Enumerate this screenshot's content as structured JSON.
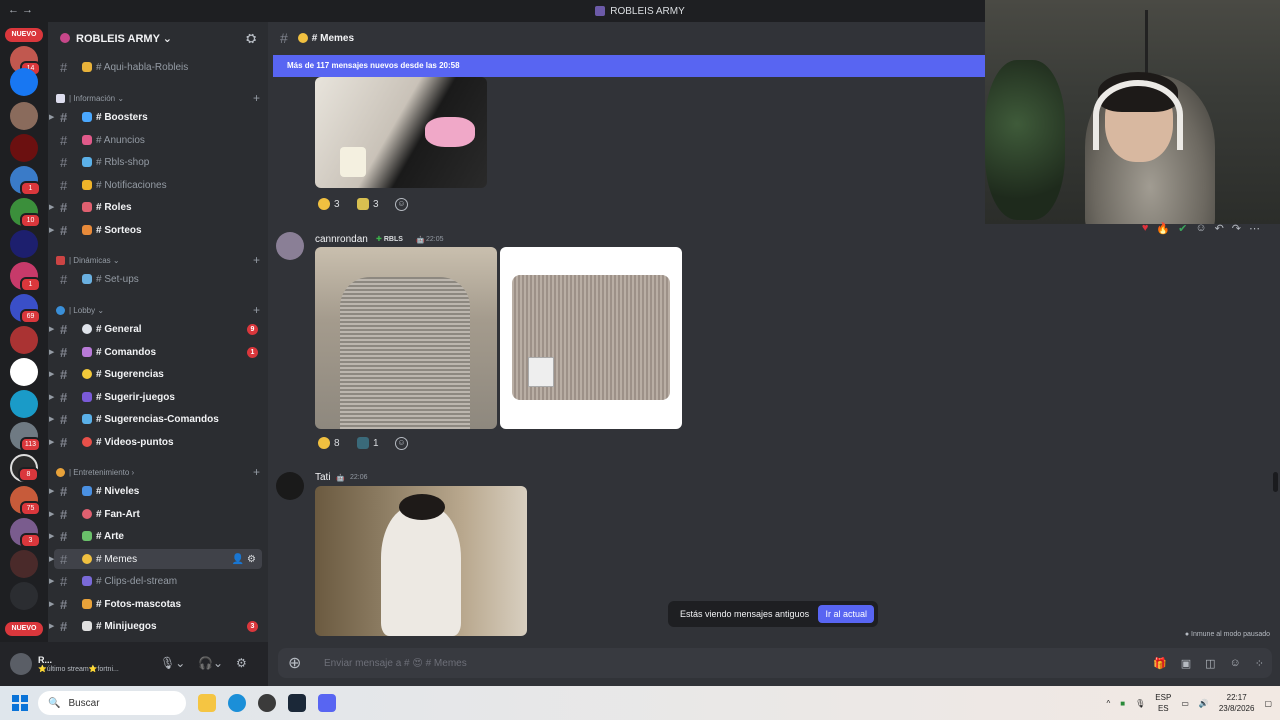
{
  "window": {
    "title": "ROBLEIS ARMY",
    "nav": "←  →"
  },
  "guild_badges": {
    "nuevo_top": "NUEVO",
    "nuevo_bottom": "NUEVO",
    "g1": "14",
    "g2": "1",
    "g3": "10",
    "g4": "1",
    "g5": "1",
    "g6": "69",
    "g7": "113",
    "g8": "8",
    "g9": "75",
    "g10": "3"
  },
  "server": {
    "name": "ROBLEIS ARMY ⌄"
  },
  "channels": {
    "aqui": "# Aqui-habla-Robleis",
    "cat_info": "| Información ⌄",
    "boosters": "# Boosters",
    "anuncios": "# Anuncios",
    "shop": "# Rbls-shop",
    "notif": "# Notificaciones",
    "roles": "# Roles",
    "sorteos": "# Sorteos",
    "cat_din": "| Dinámicas ⌄",
    "setups": "# Set-ups",
    "cat_lobby": "| Lobby ⌄",
    "general": "# General",
    "general_badge": "9",
    "comandos": "# Comandos",
    "comandos_badge": "1",
    "sugerencias": "# Sugerencias",
    "sugerir": "# Sugerir-juegos",
    "sugcom": "# Sugerencias-Comandos",
    "videos": "# Videos-puntos",
    "cat_ent": "| Entretenimiento ›",
    "niveles": "# Niveles",
    "fanart": "# Fan-Art",
    "arte": "# Arte",
    "memes": "# Memes",
    "clips": "# Clips-del-stream",
    "fotos": "# Fotos-mascotas",
    "minijuegos": "# Minijuegos",
    "minijuegos_badge": "3"
  },
  "user": {
    "name": "R...",
    "status": "⭐último stream⭐fortni..."
  },
  "chat": {
    "channel": "# Memes",
    "new_banner": "Más de 117 mensajes nuevos desde las 20:58",
    "msg1_reactions": {
      "a": "3",
      "b": "3"
    },
    "msg2": {
      "author": "cannrondan",
      "tag": "RBLS",
      "time": "22:05",
      "react_a": "8",
      "react_b": "1"
    },
    "msg3": {
      "author": "Tati",
      "time": "22:06"
    },
    "old_notice": "Estás viendo mensajes antiguos",
    "jump_button": "Ir al actual",
    "paused": "Inmune al modo pausado",
    "composer_placeholder": "Enviar mensaje a # 😍 # Memes"
  },
  "taskbar": {
    "search": "Buscar",
    "lang1": "ESP",
    "lang2": "ES",
    "time": "22:17",
    "date": "23/8/2026"
  }
}
